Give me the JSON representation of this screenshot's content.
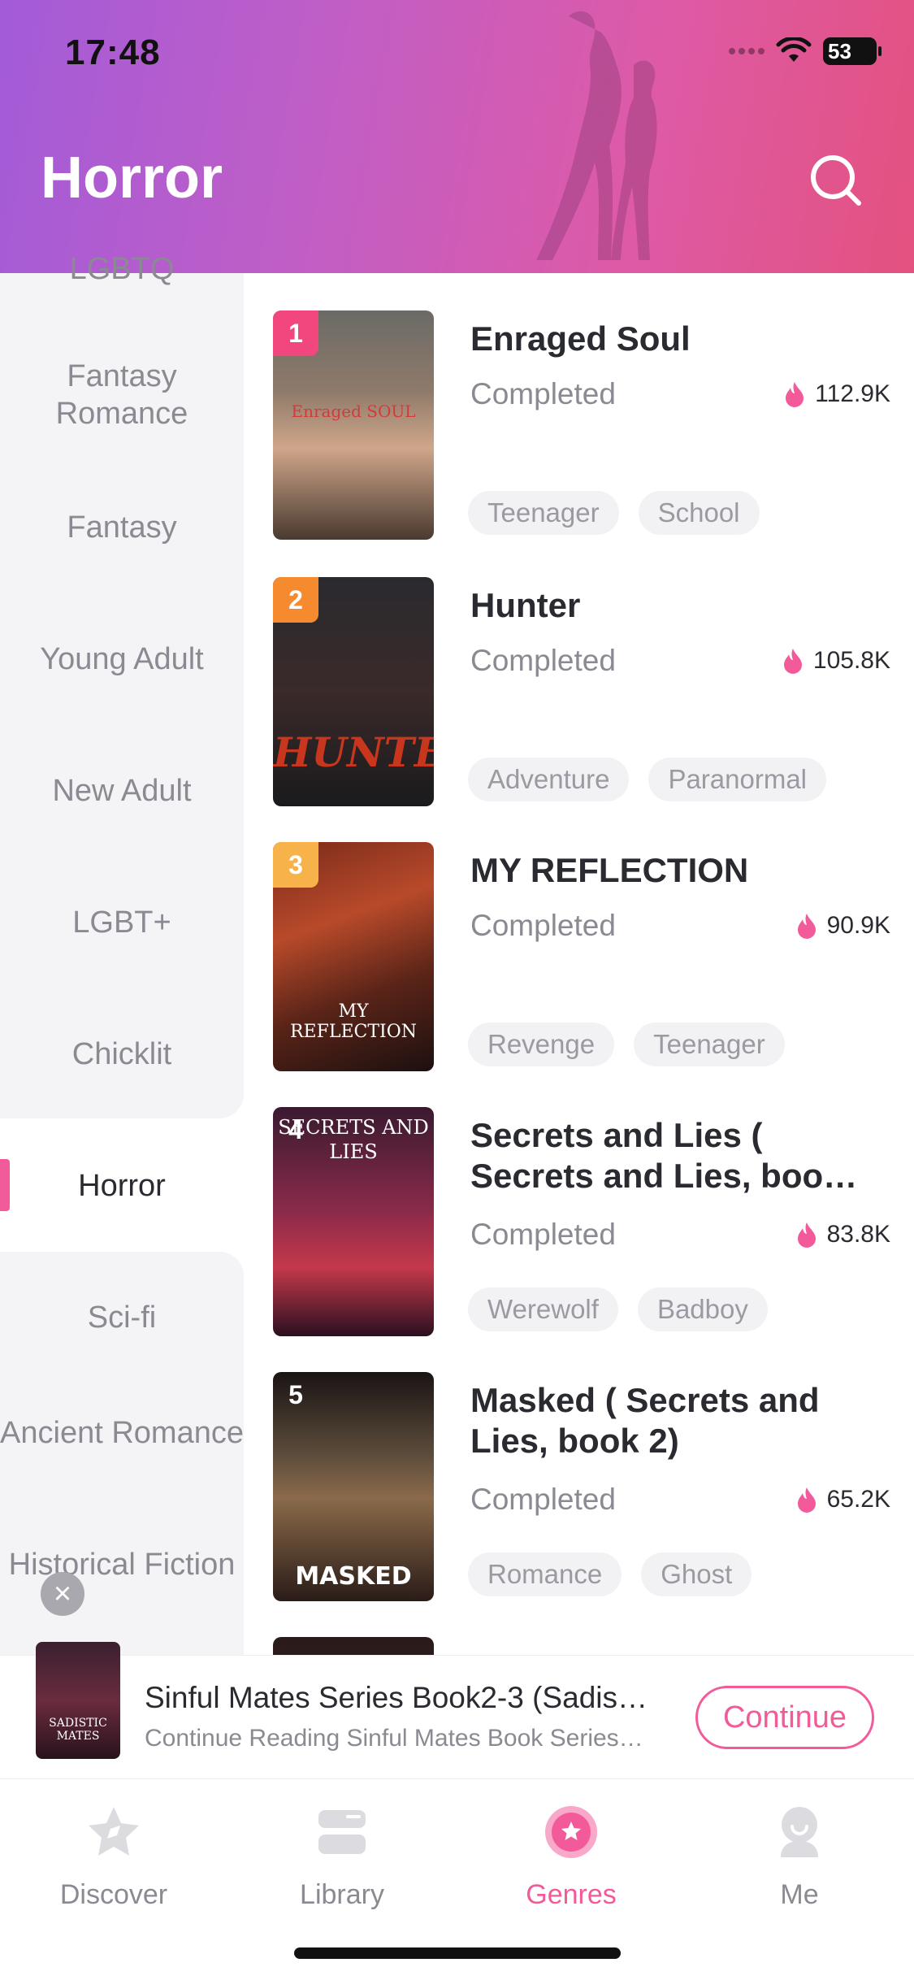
{
  "status_bar": {
    "time": "17:48",
    "battery": "53"
  },
  "header": {
    "title": "Horror"
  },
  "sidebar": {
    "items": [
      {
        "label": "LGBTQ"
      },
      {
        "label": "Fantasy Romance"
      },
      {
        "label": "Fantasy"
      },
      {
        "label": "Young Adult"
      },
      {
        "label": "New Adult"
      },
      {
        "label": "LGBT+"
      },
      {
        "label": "Chicklit"
      },
      {
        "label": "Horror"
      },
      {
        "label": "Sci-fi"
      },
      {
        "label": "Ancient Romance"
      },
      {
        "label": "Historical Fiction"
      }
    ],
    "active": "Horror"
  },
  "books": [
    {
      "rank": "1",
      "title": "Enraged Soul",
      "status": "Completed",
      "views": "112.9K",
      "tags": [
        "Teenager",
        "School"
      ],
      "cover_text": "Enraged SOUL",
      "rank_color": "#f2467e"
    },
    {
      "rank": "2",
      "title": "Hunter",
      "status": "Completed",
      "views": "105.8K",
      "tags": [
        "Adventure",
        "Paranormal"
      ],
      "cover_text": "HUNTER",
      "rank_color": "#f58a2e"
    },
    {
      "rank": "3",
      "title": "MY REFLECTION",
      "status": "Completed",
      "views": "90.9K",
      "tags": [
        "Revenge",
        "Teenager"
      ],
      "cover_text": "MY REFLECTION",
      "rank_color": "#f7b24a"
    },
    {
      "rank": "4",
      "title": "Secrets and Lies ( Secrets and Lies, boo…",
      "status": "Completed",
      "views": "83.8K",
      "tags": [
        "Werewolf",
        "Badboy"
      ],
      "cover_text": "SECRETS AND LIES",
      "rank_color": ""
    },
    {
      "rank": "5",
      "title": "Masked ( Secrets and Lies, book 2)",
      "status": "Completed",
      "views": "65.2K",
      "tags": [
        "Romance",
        "Ghost"
      ],
      "cover_text": "MASKED",
      "rank_color": ""
    }
  ],
  "continue_reading": {
    "title": "Sinful Mates Series Book2-3 (Sadis…",
    "subtitle": "Continue Reading Sinful Mates Book Series…",
    "button": "Continue",
    "cover_text": "SADISTIC MATES"
  },
  "tabbar": {
    "tabs": [
      {
        "label": "Discover",
        "icon": "discover-icon"
      },
      {
        "label": "Library",
        "icon": "library-icon"
      },
      {
        "label": "Genres",
        "icon": "genres-icon"
      },
      {
        "label": "Me",
        "icon": "me-icon"
      }
    ],
    "active": "Genres"
  },
  "colors": {
    "accent": "#f25a9a",
    "header_start": "#a35bd8",
    "header_end": "#e3527f"
  }
}
